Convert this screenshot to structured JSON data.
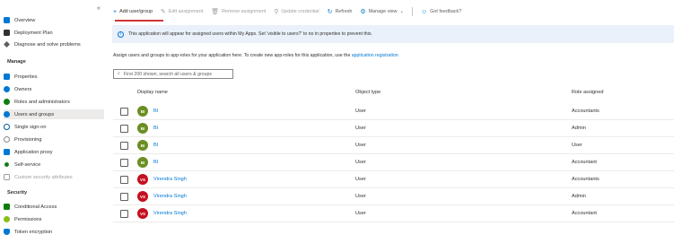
{
  "sidebar": {
    "collapse_glyph": "«",
    "items_top": [
      {
        "label": "Overview",
        "icon": "overview-icon",
        "color": "#0078d4"
      },
      {
        "label": "Deployment Plan",
        "icon": "deployment-plan-icon",
        "color": "#323130"
      },
      {
        "label": "Diagnose and solve problems",
        "icon": "diagnose-icon",
        "color": "#605e5c"
      }
    ],
    "manage_header": "Manage",
    "items_manage": [
      {
        "label": "Properties",
        "icon": "properties-icon",
        "color": "#0078d4"
      },
      {
        "label": "Owners",
        "icon": "owners-icon",
        "color": "#0078d4"
      },
      {
        "label": "Roles and administrators",
        "icon": "roles-icon",
        "color": "#107c10"
      },
      {
        "label": "Users and groups",
        "icon": "users-groups-icon",
        "color": "#0078d4"
      },
      {
        "label": "Single sign-on",
        "icon": "sso-icon",
        "color": "#005a9e"
      },
      {
        "label": "Provisioning",
        "icon": "provisioning-icon",
        "color": "#8a8886"
      },
      {
        "label": "Application proxy",
        "icon": "app-proxy-icon",
        "color": "#0078d4"
      },
      {
        "label": "Self-service",
        "icon": "self-service-icon",
        "color": "#107c10"
      },
      {
        "label": "Custom security attributes",
        "icon": "custom-attributes-icon",
        "color": "#a19f9d"
      }
    ],
    "security_header": "Security",
    "items_security": [
      {
        "label": "Conditional Access",
        "icon": "conditional-access-icon",
        "color": "#107c10"
      },
      {
        "label": "Permissions",
        "icon": "permissions-icon",
        "color": "#8cbd18"
      },
      {
        "label": "Token encryption",
        "icon": "token-encryption-icon",
        "color": "#0078d4"
      }
    ]
  },
  "toolbar": {
    "add": "Add user/group",
    "edit": "Edit assignment",
    "remove": "Remove assignment",
    "update": "Update credential",
    "refresh": "Refresh",
    "manage_view": "Manage view",
    "feedback": "Got feedback?"
  },
  "info": {
    "text": "This application will appear for assigned users within My Apps. Set 'visible to users?' to no in properties to prevent this."
  },
  "description": {
    "text": "Assign users and groups to app-roles for your application here. To create new app-roles for this application, use the",
    "link": "application registration"
  },
  "search": {
    "placeholder": "First 200 shown, search all users & groups"
  },
  "table": {
    "headers": {
      "display_name": "Display name",
      "object_type": "Object type",
      "role": "Role assigned"
    },
    "rows": [
      {
        "initials": "BI",
        "avatar_color": "#6b8e23",
        "name": "BI",
        "type": "User",
        "role": "Accountants"
      },
      {
        "initials": "BI",
        "avatar_color": "#6b8e23",
        "name": "BI",
        "type": "User",
        "role": "Admin"
      },
      {
        "initials": "BI",
        "avatar_color": "#6b8e23",
        "name": "BI",
        "type": "User",
        "role": "User"
      },
      {
        "initials": "BI",
        "avatar_color": "#6b8e23",
        "name": "BI",
        "type": "User",
        "role": "Accountant"
      },
      {
        "initials": "VS",
        "avatar_color": "#c50f1f",
        "name": "Virendra Singh",
        "type": "User",
        "role": "Accountants"
      },
      {
        "initials": "VS",
        "avatar_color": "#c50f1f",
        "name": "Virendra Singh",
        "type": "User",
        "role": "Admin"
      },
      {
        "initials": "VS",
        "avatar_color": "#c50f1f",
        "name": "Virendra Singh",
        "type": "User",
        "role": "Accountant"
      }
    ]
  }
}
